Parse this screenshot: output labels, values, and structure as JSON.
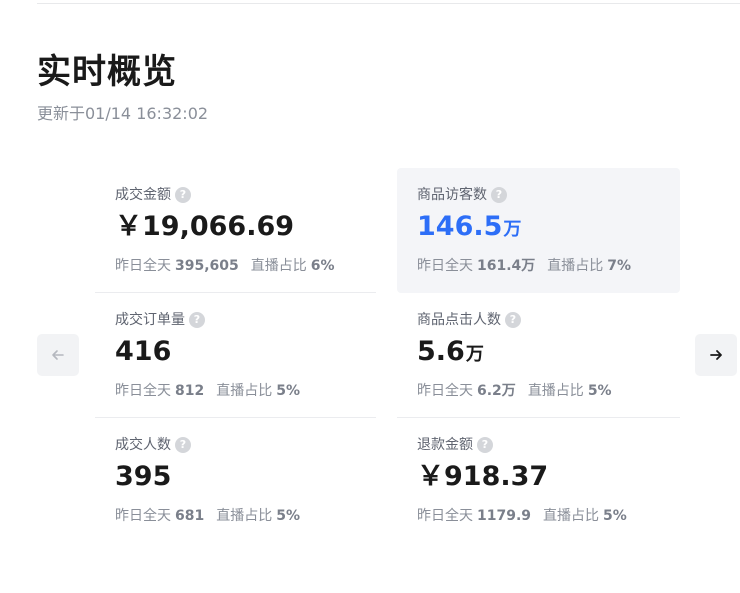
{
  "header": {
    "title": "实时概览",
    "updated": "更新于01/14 16:32:02"
  },
  "nav": {
    "prev_icon": "arrow-left-icon",
    "next_icon": "arrow-right-icon"
  },
  "metrics": [
    {
      "label": "成交金额",
      "value": "￥19,066.69",
      "unit": "",
      "yesterday_label": "昨日全天",
      "yesterday": "395,605",
      "live_label": "直播占比",
      "live": "6%"
    },
    {
      "label": "商品访客数",
      "value": "146.5",
      "unit": "万",
      "yesterday_label": "昨日全天",
      "yesterday": "161.4万",
      "live_label": "直播占比",
      "live": "7%"
    },
    {
      "label": "成交订单量",
      "value": "416",
      "unit": "",
      "yesterday_label": "昨日全天",
      "yesterday": "812",
      "live_label": "直播占比",
      "live": "5%"
    },
    {
      "label": "商品点击人数",
      "value": "5.6",
      "unit": "万",
      "yesterday_label": "昨日全天",
      "yesterday": "6.2万",
      "live_label": "直播占比",
      "live": "5%"
    },
    {
      "label": "成交人数",
      "value": "395",
      "unit": "",
      "yesterday_label": "昨日全天",
      "yesterday": "681",
      "live_label": "直播占比",
      "live": "5%"
    },
    {
      "label": "退款金额",
      "value": "￥918.37",
      "unit": "",
      "yesterday_label": "昨日全天",
      "yesterday": "1179.9",
      "live_label": "直播占比",
      "live": "5%"
    }
  ],
  "colors": {
    "accent_blue": "#2d6ef7",
    "highlight_bg": "#f4f5f8"
  }
}
